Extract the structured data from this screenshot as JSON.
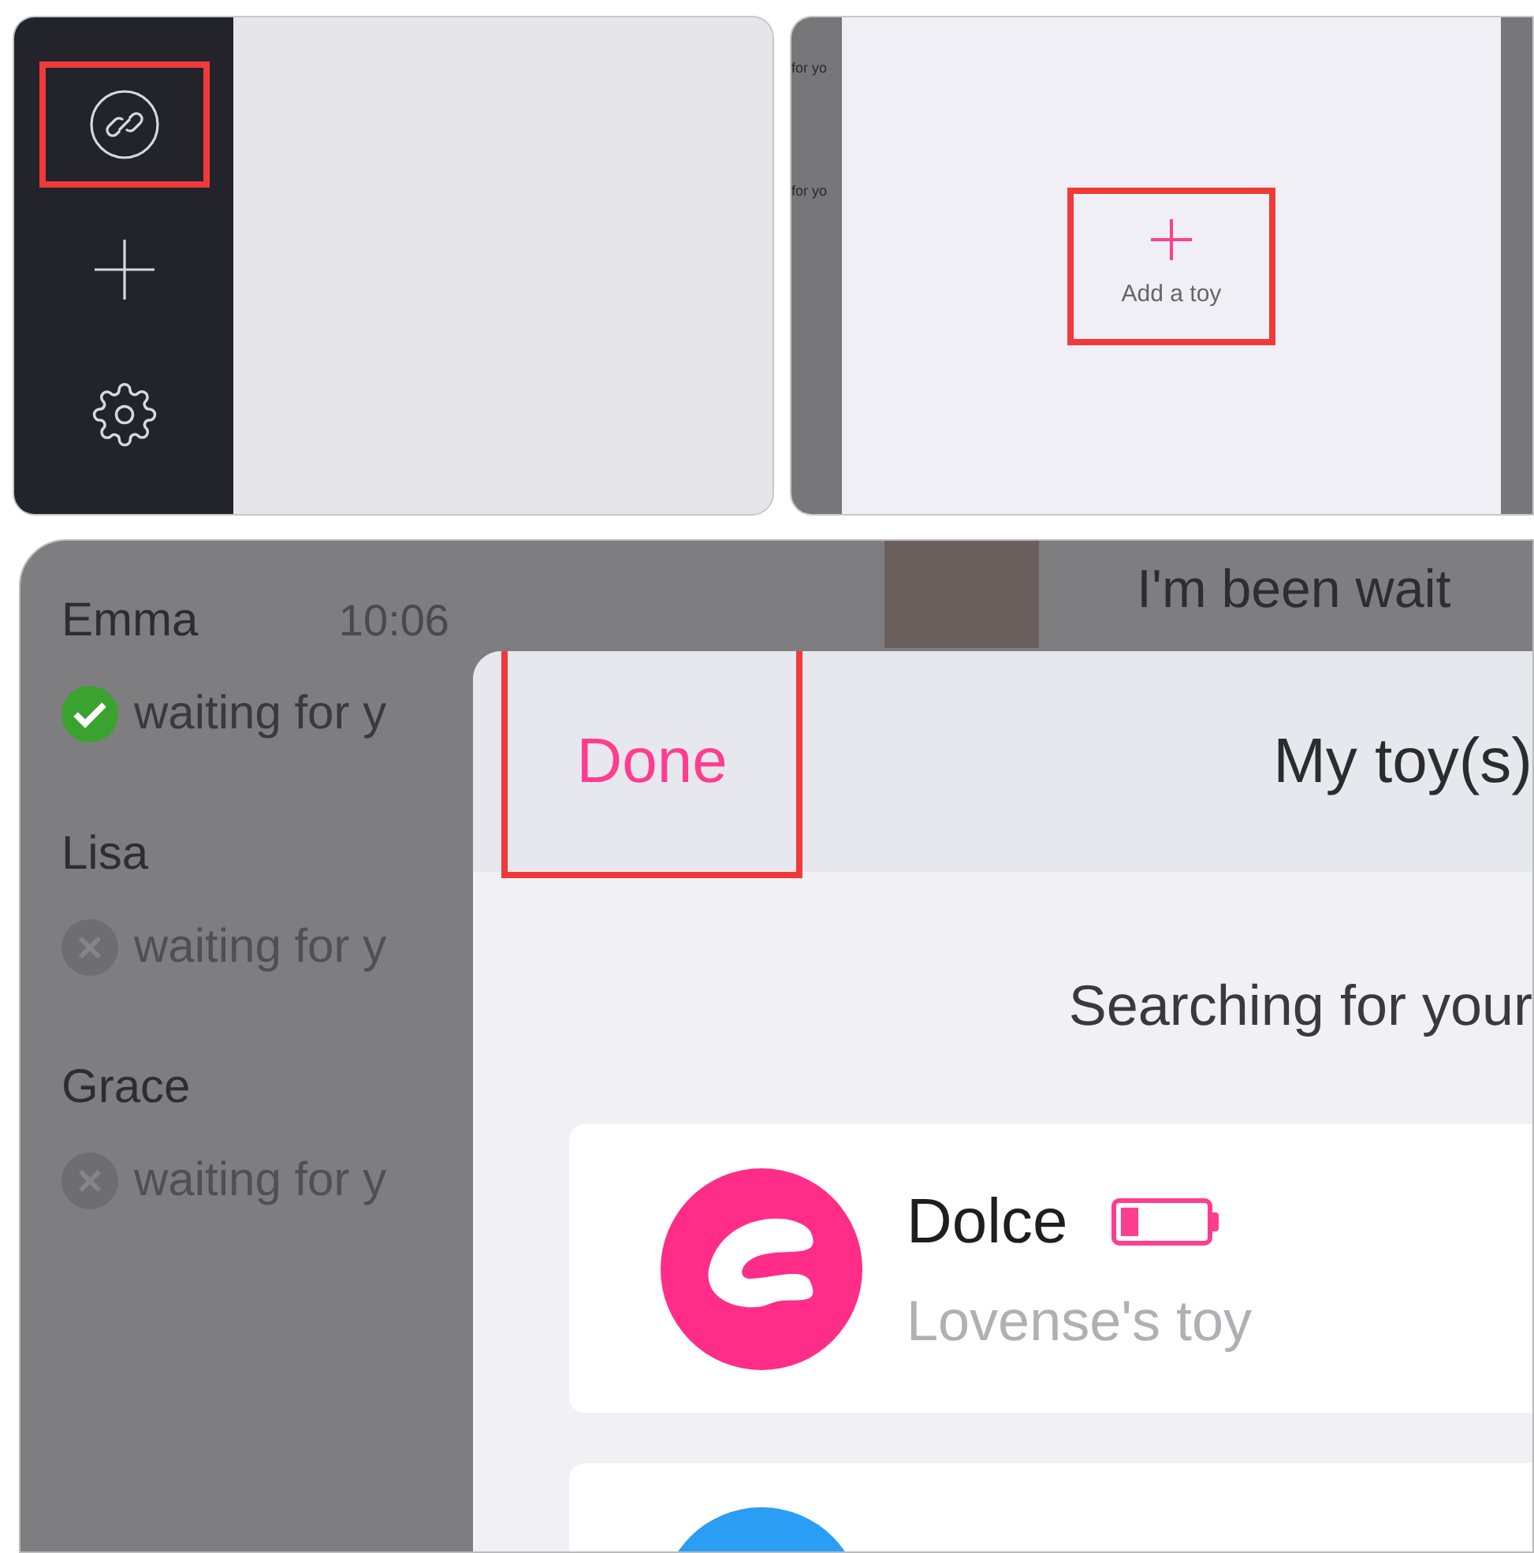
{
  "top_left_panel": {
    "sidebar": [
      {
        "kind": "link",
        "highlighted": true
      },
      {
        "kind": "add",
        "highlighted": false
      },
      {
        "kind": "settings",
        "highlighted": false
      }
    ]
  },
  "top_right_panel": {
    "side_texts": [
      "for yo",
      "for yo"
    ],
    "add_toy": {
      "label": "Add a toy",
      "highlighted": true
    }
  },
  "bottom_panel": {
    "contacts": [
      {
        "name": "Emma",
        "time": "10:06",
        "status": "waiting for y",
        "connected": true
      },
      {
        "name": "Lisa",
        "status": "waiting for y",
        "connected": false
      },
      {
        "name": "Grace",
        "status": "waiting for y",
        "connected": false
      }
    ],
    "chat": {
      "message": "I'm been wait"
    },
    "modal": {
      "done_button": {
        "label": "Done",
        "highlighted": true
      },
      "title": "My toy(s)",
      "searching": "Searching for your",
      "toys": [
        {
          "name": "Dolce",
          "subtitle": "Lovense's toy",
          "level": 0.2,
          "color": "#ff2d87"
        },
        {
          "color": "#2a9df4"
        }
      ]
    }
  }
}
